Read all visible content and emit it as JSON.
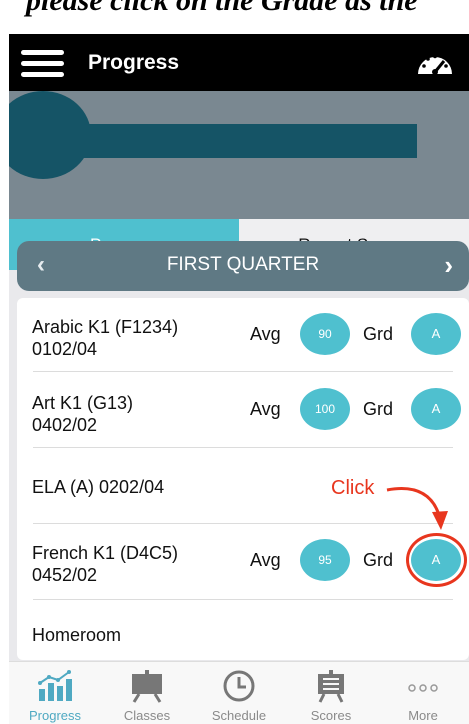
{
  "caption": {
    "text": "please click on the Grade as the"
  },
  "header": {
    "title": "Progress",
    "menu_icon": "hamburger-icon",
    "right_icon": "speedometer-icon"
  },
  "tabs": [
    {
      "label": "Progress",
      "active": true
    },
    {
      "label": "Recent Scores",
      "active": false
    }
  ],
  "quarter": {
    "label": "FIRST QUARTER"
  },
  "courses": [
    {
      "name": "Arabic K1 (F1234)",
      "code": "0102/04",
      "avg_label": "Avg",
      "avg": "90",
      "grd_label": "Grd",
      "grade": "A"
    },
    {
      "name": "Art K1 (G13)",
      "code": "0402/02",
      "avg_label": "Avg",
      "avg": "100",
      "grd_label": "Grd",
      "grade": "A"
    },
    {
      "name": "ELA (A) 0202/04",
      "code": ""
    },
    {
      "name": "French K1 (D4C5)",
      "code": "0452/02",
      "avg_label": "Avg",
      "avg": "95",
      "grd_label": "Grd",
      "grade": "A"
    },
    {
      "name": "Homeroom",
      "code": ""
    }
  ],
  "annotation": {
    "text": "Click",
    "color": "#e8361e"
  },
  "bottom_nav": [
    {
      "label": "Progress",
      "icon": "bar-chart-icon",
      "active": true
    },
    {
      "label": "Classes",
      "icon": "easel-icon",
      "active": false
    },
    {
      "label": "Schedule",
      "icon": "clock-icon",
      "active": false
    },
    {
      "label": "Scores",
      "icon": "scoreboard-icon",
      "active": false
    },
    {
      "label": "More",
      "icon": "more-dots-icon",
      "active": false
    }
  ],
  "colors": {
    "accent": "#4fc0cf",
    "header_bg": "#000000",
    "quarter_bg": "#5f7984",
    "banner_bg": "#7a8891",
    "banner_dark": "#155466"
  }
}
